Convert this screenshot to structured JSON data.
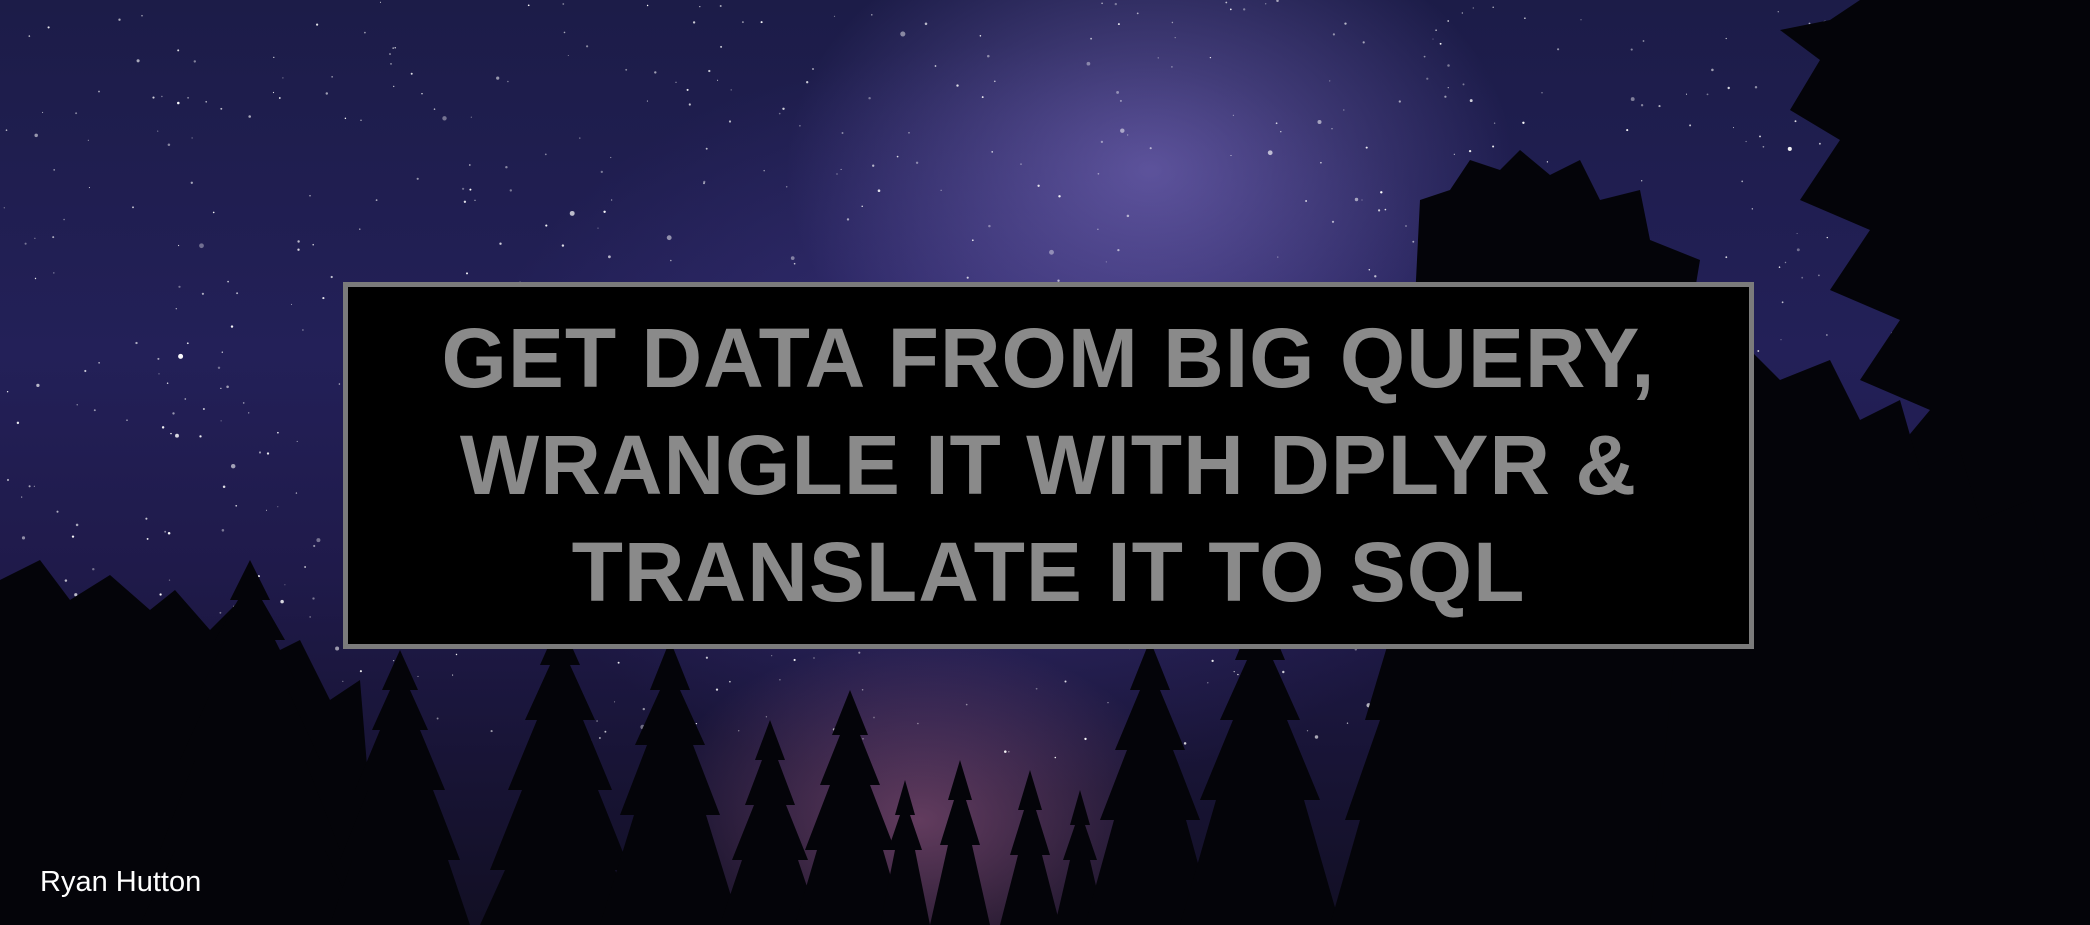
{
  "slide": {
    "title_lines": [
      "GET DATA FROM BIG QUERY,",
      "WRANGLE IT WITH DPLYR &",
      "TRANSLATE IT TO SQL"
    ],
    "credit": "Ryan Hutton"
  },
  "colors": {
    "title_box_background": "#000000",
    "title_box_border": "#7b7b7b",
    "title_text": "#8a8a8a",
    "credit_text": "#ffffff",
    "sky_top": "#1c1c48",
    "milky_way": "#8a7ad2",
    "horizon_glow": "#be6e96",
    "tree_silhouette": "#040409"
  }
}
